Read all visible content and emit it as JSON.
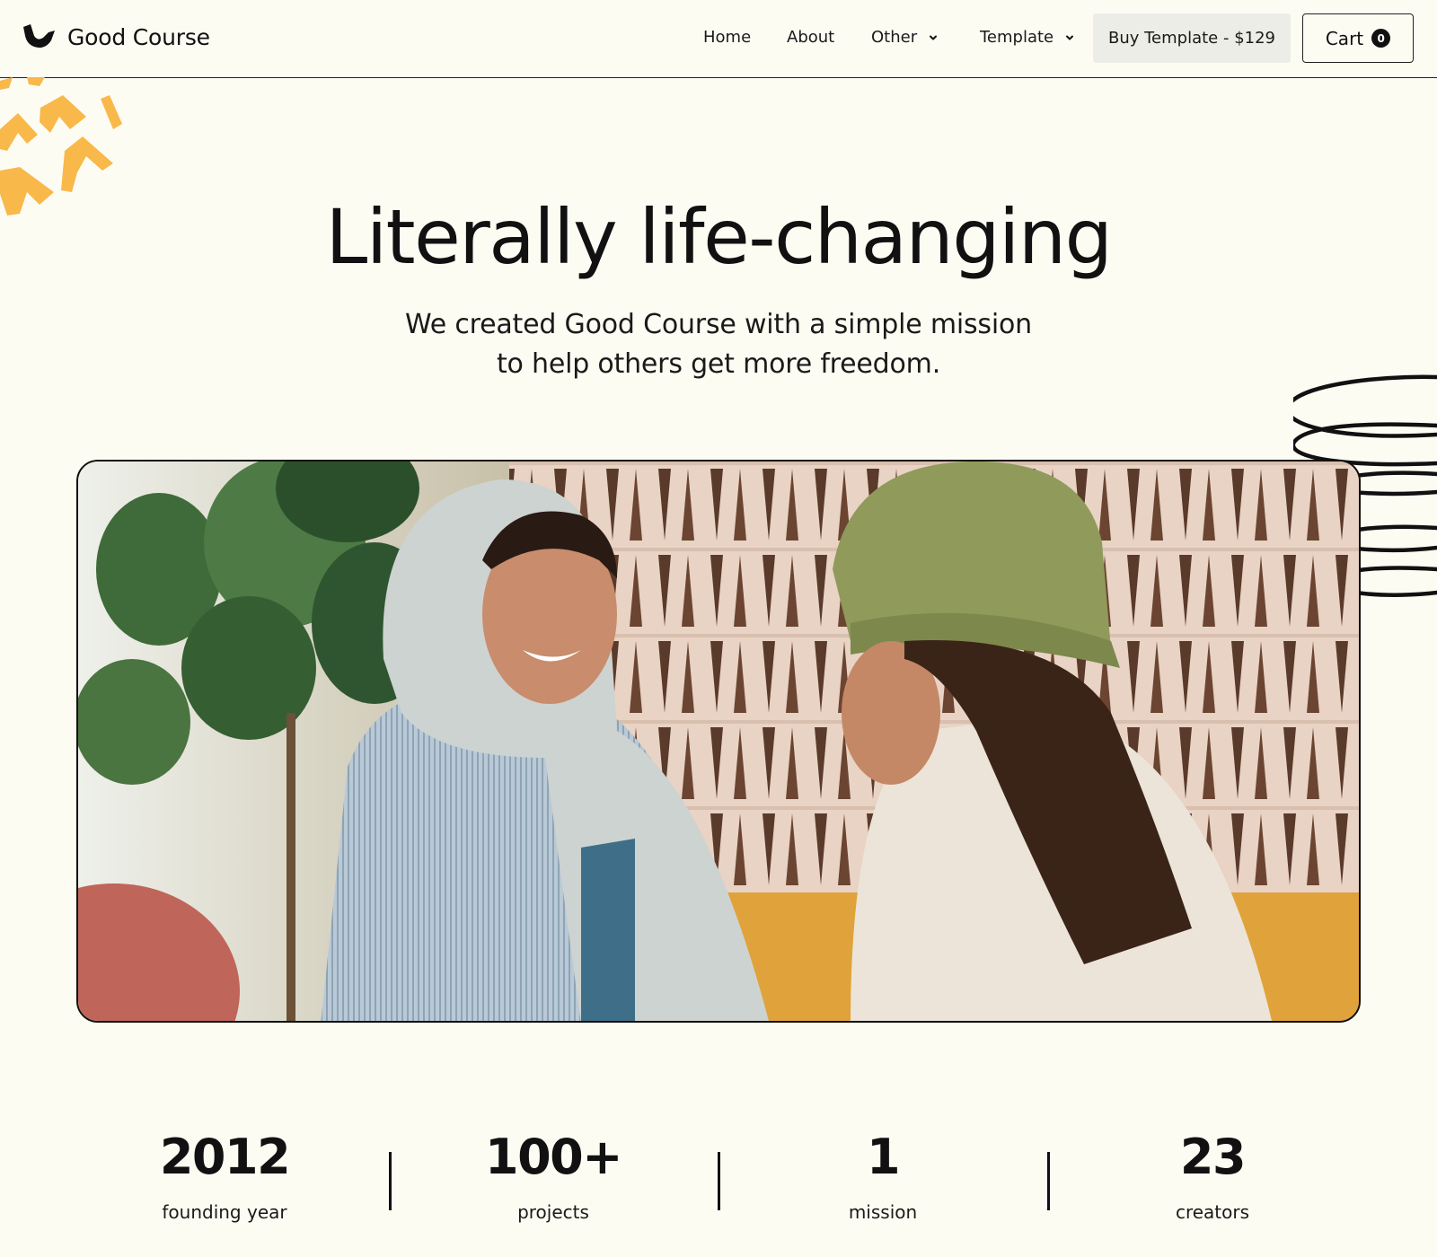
{
  "brand": {
    "name": "Good Course",
    "logo_icon": "brand-logo-icon"
  },
  "nav": {
    "links": [
      "Home",
      "About",
      "Other",
      "Template"
    ],
    "buy_label": "Buy Template - $129",
    "cart_label": "Cart",
    "cart_count": "0"
  },
  "hero": {
    "title": "Literally life-changing",
    "subtitle_line1": "We created Good Course with a simple mission",
    "subtitle_line2": "to help others get more freedom."
  },
  "stats": [
    {
      "value": "2012",
      "label": "founding year"
    },
    {
      "value": "100+",
      "label": "projects"
    },
    {
      "value": "1",
      "label": "mission"
    },
    {
      "value": "23",
      "label": "creators"
    }
  ],
  "colors": {
    "background": "#FDFCF3",
    "text": "#111111",
    "accent_orange": "#F9B84A",
    "button_bg": "#EDEDE8"
  }
}
